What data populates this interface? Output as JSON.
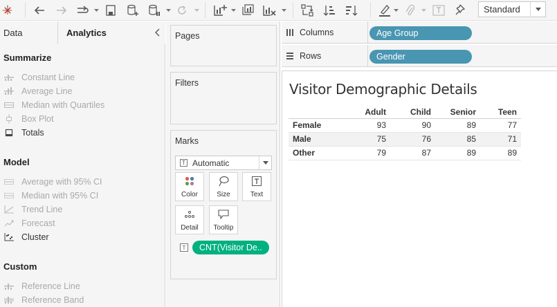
{
  "toolbar": {
    "icons": [
      "tableau-logo-icon",
      "undo-icon",
      "redo-icon",
      "replay-icon",
      "save-icon",
      "new-datasource-icon",
      "pause-updates-icon",
      "refresh-icon",
      "new-worksheet-icon",
      "duplicate-sheet-icon",
      "clear-sheet-icon",
      "swap-icon",
      "sort-ascending-icon",
      "sort-descending-icon",
      "highlight-icon",
      "group-icon",
      "label-icon",
      "pin-icon"
    ],
    "fit_select": "Standard"
  },
  "left_panel": {
    "tabs": [
      {
        "label": "Data",
        "active": false
      },
      {
        "label": "Analytics",
        "active": true
      }
    ],
    "sections": [
      {
        "title": "Summarize",
        "items": [
          {
            "label": "Constant Line",
            "enabled": false,
            "icon": "constant-line-icon"
          },
          {
            "label": "Average Line",
            "enabled": false,
            "icon": "average-line-icon"
          },
          {
            "label": "Median with Quartiles",
            "enabled": false,
            "icon": "median-quartiles-icon"
          },
          {
            "label": "Box Plot",
            "enabled": false,
            "icon": "box-plot-icon"
          },
          {
            "label": "Totals",
            "enabled": true,
            "icon": "totals-icon"
          }
        ]
      },
      {
        "title": "Model",
        "items": [
          {
            "label": "Average with 95% CI",
            "enabled": false,
            "icon": "average-ci-icon"
          },
          {
            "label": "Median with 95% CI",
            "enabled": false,
            "icon": "median-ci-icon"
          },
          {
            "label": "Trend Line",
            "enabled": false,
            "icon": "trend-line-icon"
          },
          {
            "label": "Forecast",
            "enabled": false,
            "icon": "forecast-icon"
          },
          {
            "label": "Cluster",
            "enabled": true,
            "icon": "cluster-icon"
          }
        ]
      },
      {
        "title": "Custom",
        "items": [
          {
            "label": "Reference Line",
            "enabled": false,
            "icon": "reference-line-icon"
          },
          {
            "label": "Reference Band",
            "enabled": false,
            "icon": "reference-band-icon"
          }
        ]
      }
    ]
  },
  "cards": {
    "pages": "Pages",
    "filters": "Filters",
    "marks": {
      "title": "Marks",
      "type": "Automatic",
      "buttons": [
        {
          "label": "Color",
          "icon": "color-dots-icon"
        },
        {
          "label": "Size",
          "icon": "size-lasso-icon"
        },
        {
          "label": "Text",
          "icon": "text-box-icon"
        },
        {
          "label": "Detail",
          "icon": "detail-dots-icon"
        },
        {
          "label": "Tooltip",
          "icon": "tooltip-bubble-icon"
        }
      ],
      "field": "CNT(Visitor De.."
    }
  },
  "shelves": {
    "columns": {
      "label": "Columns",
      "pill": "Age Group",
      "pill_color": "#4996b2"
    },
    "rows": {
      "label": "Rows",
      "pill": "Gender",
      "pill_color": "#4996b2"
    }
  },
  "view": {
    "title": "Visitor Demographic Details",
    "columns": [
      "Adult",
      "Child",
      "Senior",
      "Teen"
    ],
    "rows": [
      {
        "label": "Female",
        "values": [
          93,
          90,
          89,
          77
        ]
      },
      {
        "label": "Male",
        "values": [
          75,
          76,
          85,
          71
        ]
      },
      {
        "label": "Other",
        "values": [
          79,
          87,
          89,
          89
        ]
      }
    ]
  },
  "colors": {
    "dimension_pill": "#4996b2",
    "measure_pill": "#00b180"
  }
}
